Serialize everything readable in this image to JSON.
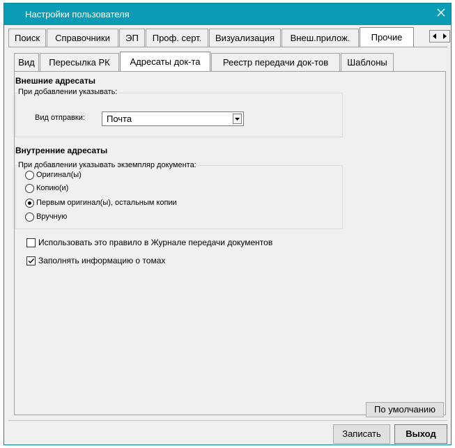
{
  "window": {
    "title": "Настройки пользователя"
  },
  "tabs_row1": [
    {
      "label": "Поиск",
      "selected": false
    },
    {
      "label": "Справочники",
      "selected": false
    },
    {
      "label": "ЭП",
      "selected": false
    },
    {
      "label": "Проф. серт.",
      "selected": false
    },
    {
      "label": "Визуализация",
      "selected": false
    },
    {
      "label": "Внеш.прилож.",
      "selected": false
    },
    {
      "label": "Прочие",
      "selected": true
    }
  ],
  "tabs_row2": [
    {
      "label": "Вид",
      "selected": false
    },
    {
      "label": "Пересылка РК",
      "selected": false
    },
    {
      "label": "Адресаты док-та",
      "selected": true
    },
    {
      "label": "Реестр передачи док-тов",
      "selected": false
    },
    {
      "label": "Шаблоны",
      "selected": false
    }
  ],
  "external": {
    "title": "Внешние адресаты",
    "group_label": "При добавлении указывать:",
    "send_type_label": "Вид отправки:",
    "send_type_value": "Почта"
  },
  "internal": {
    "title": "Внутренние адресаты",
    "group_label": "При добавлении указывать экземпляр документа:",
    "options": [
      {
        "label": "Оригинал(ы)",
        "selected": false
      },
      {
        "label": "Копию(и)",
        "selected": false
      },
      {
        "label": "Первым оригинал(ы), остальным копии",
        "selected": true
      },
      {
        "label": "Вручную",
        "selected": false
      }
    ]
  },
  "checkboxes": [
    {
      "label": "Использовать это правило в Журнале передачи документов",
      "checked": false
    },
    {
      "label": "Заполнять информацию о томах",
      "checked": true
    }
  ],
  "buttons": {
    "default": "По умолчанию",
    "save": "Записать",
    "exit": "Выход"
  },
  "colors": {
    "titlebar": "#0a9cb4",
    "background": "#f0f0f0"
  }
}
